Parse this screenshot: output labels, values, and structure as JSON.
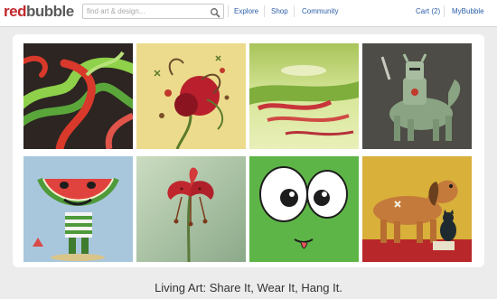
{
  "header": {
    "logo_part1": "red",
    "logo_part2": "bubble",
    "search_placeholder": "find art & design...",
    "nav": [
      "Explore",
      "Shop",
      "Community"
    ],
    "cart": "Cart (2)",
    "account": "MyBubble"
  },
  "hero": {
    "artworks": [
      "green-red-tentacles-artwork",
      "red-floral-swirl-artwork",
      "watermelon-landscape-artwork",
      "robot-knight-horse-artwork",
      "watermelon-head-character-artwork",
      "red-lily-flower-artwork",
      "googly-eyes-face-artwork",
      "dog-and-cat-artwork"
    ]
  },
  "tagline": "Living Art: Share It, Wear It, Hang It.",
  "colors": {
    "brand_red": "#c1272d",
    "link_blue": "#2a5da8"
  }
}
